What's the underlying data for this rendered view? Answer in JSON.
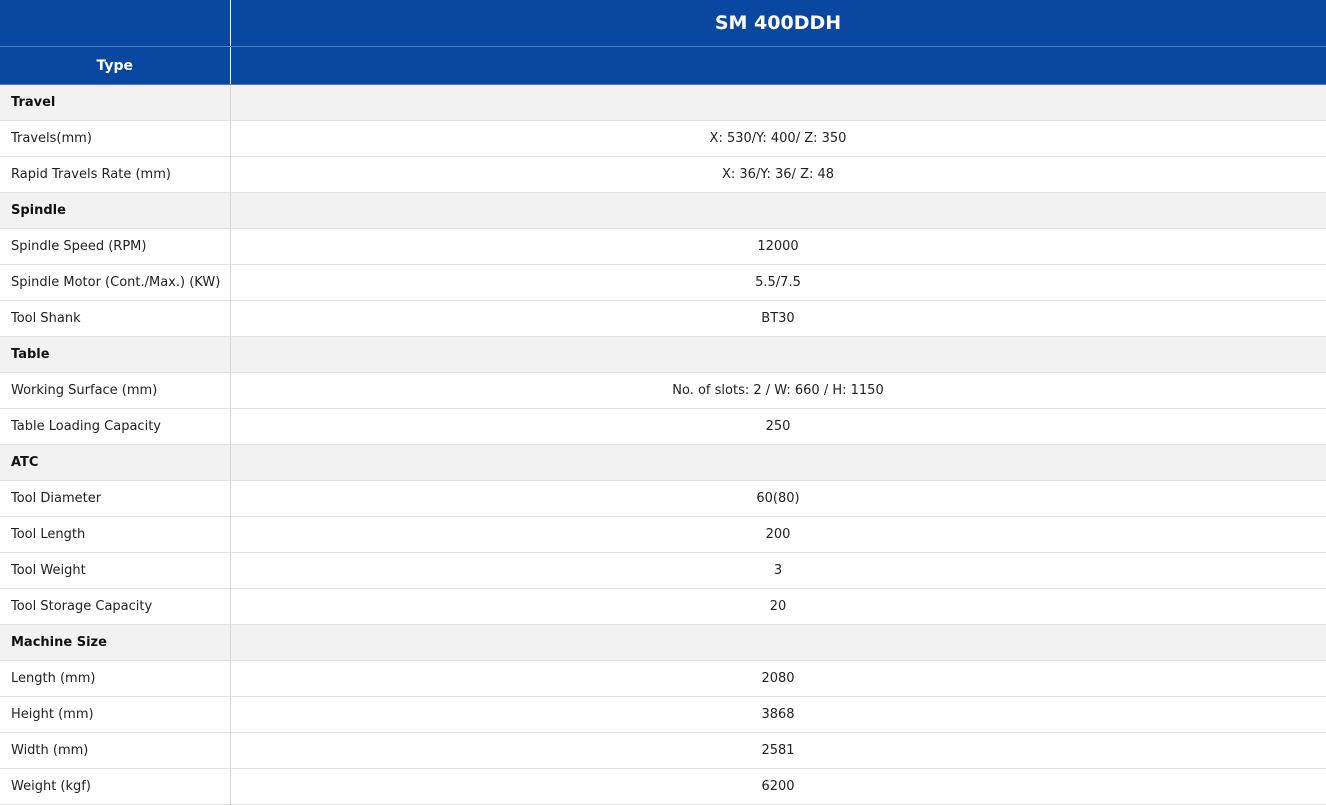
{
  "header": {
    "model": "SM 400DDH",
    "type_label": "Type"
  },
  "rows": [
    {
      "kind": "section",
      "label": "Travel",
      "value": ""
    },
    {
      "kind": "item",
      "label": "Travels(mm)",
      "value": "X: 530/Y: 400/ Z: 350"
    },
    {
      "kind": "item",
      "label": "Rapid Travels Rate (mm)",
      "value": "X: 36/Y: 36/ Z: 48"
    },
    {
      "kind": "section",
      "label": "Spindle",
      "value": ""
    },
    {
      "kind": "item",
      "label": "Spindle Speed (RPM)",
      "value": "12000"
    },
    {
      "kind": "item",
      "label": "Spindle Motor (Cont./Max.) (KW)",
      "value": "5.5/7.5"
    },
    {
      "kind": "item",
      "label": "Tool Shank",
      "value": "BT30"
    },
    {
      "kind": "section",
      "label": "Table",
      "value": ""
    },
    {
      "kind": "item",
      "label": "Working Surface (mm)",
      "value": "No. of slots: 2 / W: 660 / H: 1150"
    },
    {
      "kind": "item",
      "label": "Table Loading Capacity",
      "value": "250"
    },
    {
      "kind": "section",
      "label": "ATC",
      "value": ""
    },
    {
      "kind": "item",
      "label": "Tool Diameter",
      "value": "60(80)"
    },
    {
      "kind": "item",
      "label": "Tool Length",
      "value": "200"
    },
    {
      "kind": "item",
      "label": "Tool Weight",
      "value": "3"
    },
    {
      "kind": "item",
      "label": "Tool Storage Capacity",
      "value": "20"
    },
    {
      "kind": "section",
      "label": "Machine Size",
      "value": ""
    },
    {
      "kind": "item",
      "label": "Length (mm)",
      "value": "2080"
    },
    {
      "kind": "item",
      "label": "Height (mm)",
      "value": "3868"
    },
    {
      "kind": "item",
      "label": "Width (mm)",
      "value": "2581"
    },
    {
      "kind": "item",
      "label": "Weight (kgf)",
      "value": "6200"
    }
  ],
  "colors": {
    "header_bg": "#0a47a0",
    "header_text": "#ffffff",
    "section_bg": "#f2f2f2",
    "border": "#e2e2e2"
  }
}
